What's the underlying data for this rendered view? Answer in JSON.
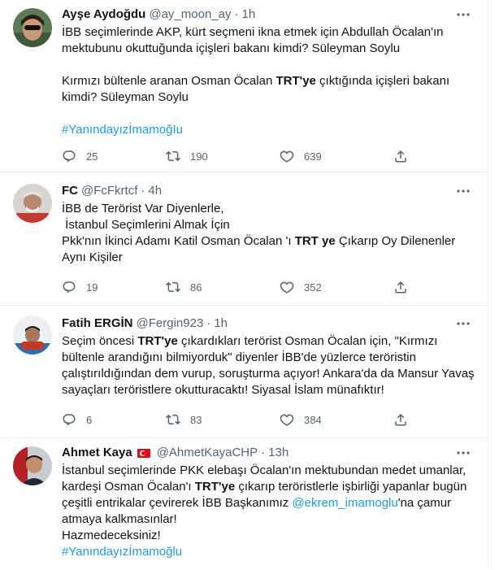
{
  "tweets": [
    {
      "name": "Ayşe Aydoğdu",
      "handle": "@ay_moon_ay",
      "time": "1h",
      "lines": [
        "İBB seçimlerinde AKP, kürt seçmeni ikna etmek için Abdullah Öcalan'ın",
        "mektubunu okuttuğunda içişleri bakanı kimdi? Süleyman Soylu",
        "Kırmızı bültenle aranan Osman Öcalan ",
        "TRT'ye",
        " çıktığında içişleri bakanı",
        "kimdi? Süleyman Soylu",
        "#YanındayızİmamoğIu"
      ],
      "replies": "25",
      "retweets": "190",
      "likes": "639"
    },
    {
      "name": "FC",
      "handle": "@FcFkrtcf",
      "time": "4h",
      "lines": [
        "İBB de Terörist Var Diyenlerle,",
        " İstanbul Seçimlerini Almak İçin",
        "Pkk'nın İkinci Adamı Katil Osman Öcalan 'ı ",
        "TRT ye",
        " Çıkarıp Oy Dilenenler",
        "Aynı Kişiler"
      ],
      "replies": "19",
      "retweets": "86",
      "likes": "352"
    },
    {
      "name": "Fatih ERGİN",
      "handle": "@Fergin923",
      "time": "1h",
      "lines": [
        "Seçim öncesi ",
        "TRT'ye",
        " çıkardıkları terörist Osman Öcalan için, \"Kırmızı",
        "bültenle arandığını bilmiyorduk\" diyenler İBB'de yüzlerce teröristin",
        "çalıştırıldığından dem vurup, soruşturma açıyor! Ankara'da da Mansur Yavaş",
        "sayaçları teröristlere okutturacaktı! Siyasal İslam münafıktır!"
      ],
      "replies": "6",
      "retweets": "83",
      "likes": "384"
    },
    {
      "name": "Ahmet Kaya",
      "handle": "@AhmetKayaCHP",
      "time": "13h",
      "lines": [
        "İstanbul seçimlerinde PKK elebaşı Öcalan'ın mektubundan medet umanlar,",
        "kardeşi Osman Öcalan'ı ",
        "TRT'ye",
        " çıkarıp teröristlerle işbirliği yapanlar bugün",
        "çeşitli entrikalar çevirerek İBB Başkanımız ",
        "@ekrem_imamoglu",
        "'na çamur",
        "atmaya kalkmasınlar!",
        "Hazmedeceksiniz!",
        "#Yanındayızİmamoğlu"
      ]
    }
  ],
  "colors": {
    "link": "#1d9bf0",
    "secondary": "#536471",
    "border": "#eff3f4"
  },
  "icons": [
    "more-icon",
    "reply-icon",
    "retweet-icon",
    "like-icon",
    "share-icon",
    "turkey-flag-icon"
  ]
}
